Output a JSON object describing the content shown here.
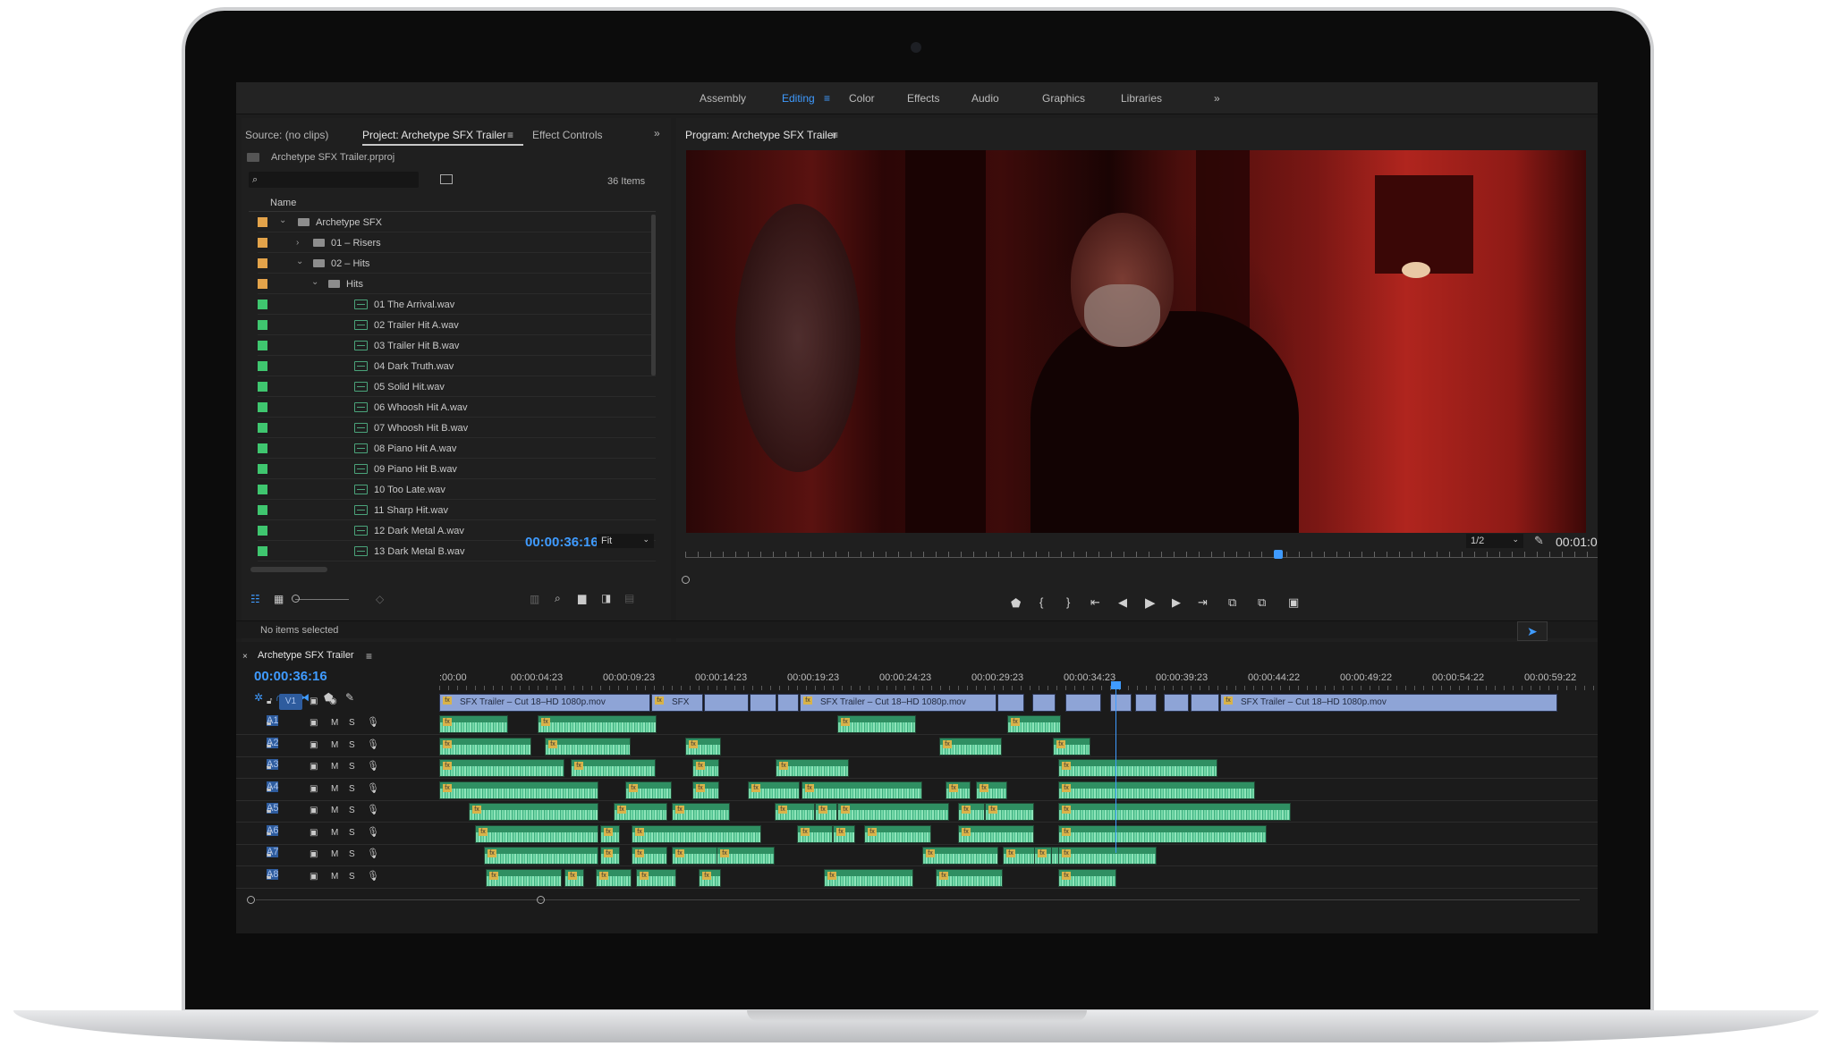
{
  "workspaces": {
    "assembly": "Assembly",
    "editing": "Editing",
    "color": "Color",
    "effects": "Effects",
    "audio": "Audio",
    "graphics": "Graphics",
    "libraries": "Libraries",
    "more": "»"
  },
  "project_panel": {
    "tabs": {
      "source": "Source: (no clips)",
      "project": "Project: Archetype SFX Trailer",
      "effect_controls": "Effect Controls",
      "more": "»"
    },
    "file_name": "Archetype SFX Trailer.prproj",
    "item_count": "36 Items",
    "column_name": "Name",
    "status": "No items selected",
    "colors": {
      "folder": "#e3a34a",
      "audio": "#3fc66f"
    },
    "rows": [
      {
        "label": "Archetype SFX",
        "type": "folder",
        "expanded": true
      },
      {
        "label": "01 – Risers",
        "type": "folder",
        "expanded": false
      },
      {
        "label": "02 – Hits",
        "type": "folder",
        "expanded": true
      },
      {
        "label": "Hits",
        "type": "folder",
        "expanded": true
      },
      {
        "label": "01 The Arrival.wav",
        "type": "audio"
      },
      {
        "label": "02 Trailer Hit A.wav",
        "type": "audio"
      },
      {
        "label": "03 Trailer Hit B.wav",
        "type": "audio"
      },
      {
        "label": "04 Dark Truth.wav",
        "type": "audio"
      },
      {
        "label": "05 Solid Hit.wav",
        "type": "audio"
      },
      {
        "label": "06 Whoosh Hit A.wav",
        "type": "audio"
      },
      {
        "label": "07 Whoosh Hit B.wav",
        "type": "audio"
      },
      {
        "label": "08 Piano Hit A.wav",
        "type": "audio"
      },
      {
        "label": "09 Piano Hit B.wav",
        "type": "audio"
      },
      {
        "label": "10 Too Late.wav",
        "type": "audio"
      },
      {
        "label": "11 Sharp Hit.wav",
        "type": "audio"
      },
      {
        "label": "12 Dark Metal A.wav",
        "type": "audio"
      },
      {
        "label": "13 Dark Metal B.wav",
        "type": "audio"
      }
    ]
  },
  "program_monitor": {
    "title": "Program: Archetype SFX Trailer",
    "timecode": "00:00:36:16",
    "fit": "Fit",
    "resolution": "1/2",
    "duration": "00:01:0"
  },
  "timeline": {
    "sequence_name": "Archetype SFX Trailer",
    "timecode": "00:00:36:16",
    "ruler": [
      ":00:00",
      "00:00:04:23",
      "00:00:09:23",
      "00:00:14:23",
      "00:00:19:23",
      "00:00:24:23",
      "00:00:29:23",
      "00:00:34:23",
      "00:00:39:23",
      "00:00:44:22",
      "00:00:49:22",
      "00:00:54:22",
      "00:00:59:22"
    ],
    "video_track": "V1",
    "audio_tracks": [
      "A1",
      "A2",
      "A3",
      "A4",
      "A5",
      "A6",
      "A7",
      "A8"
    ],
    "mute_label": "M",
    "solo_label": "S",
    "video_clips": [
      {
        "label": "SFX Trailer – Cut 18–HD 1080p.mov"
      },
      {
        "label": "SFX"
      },
      {
        "label": "SFX Trailer – Cut 18–HD 1080p.mov"
      },
      {
        "label": "SFX Trailer – Cut 18–HD 1080p.mov"
      }
    ],
    "fx_label": "fx"
  }
}
